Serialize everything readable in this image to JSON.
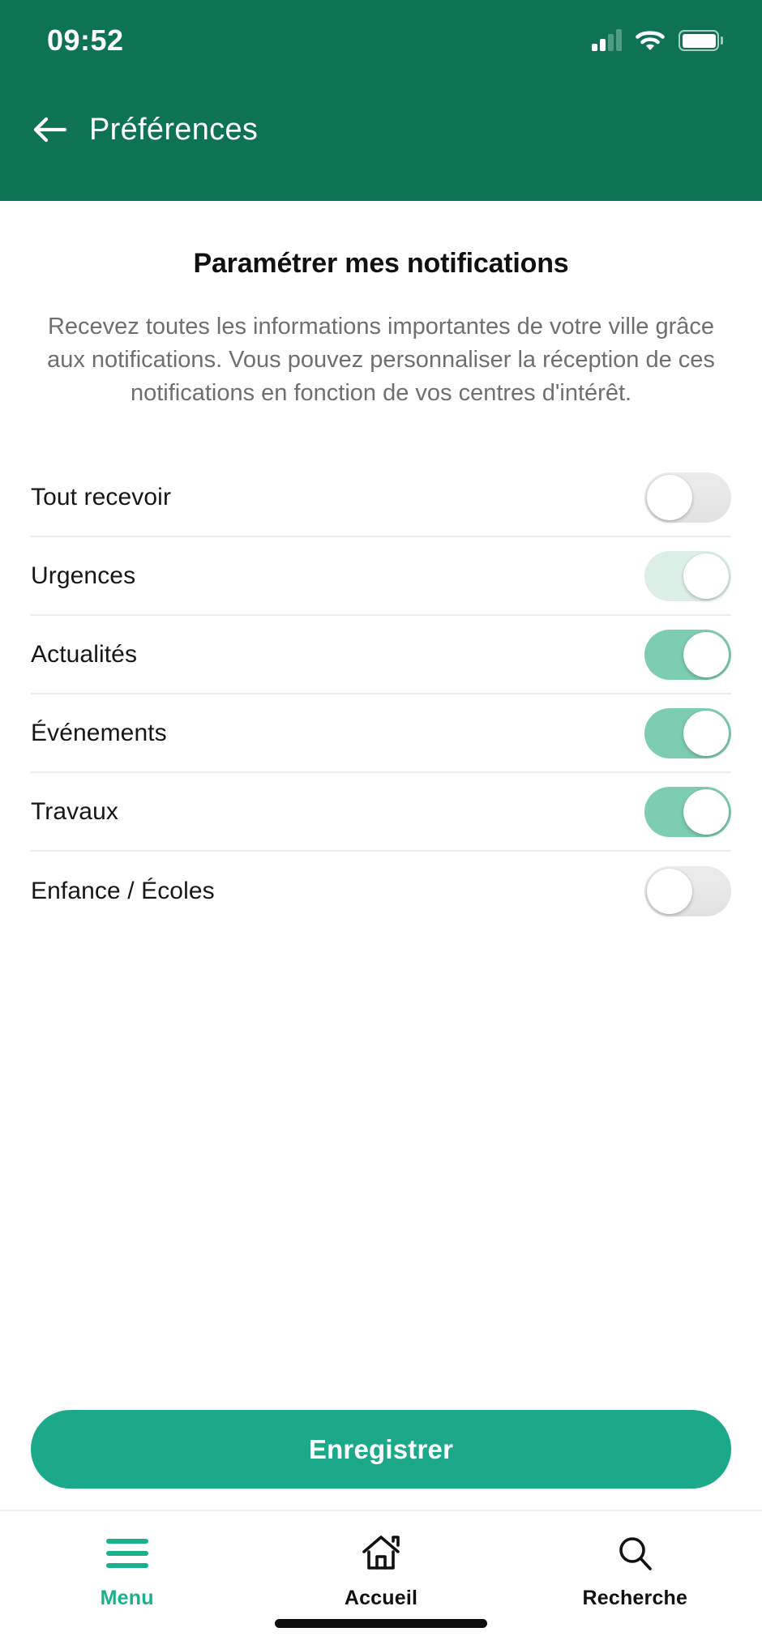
{
  "statusbar": {
    "time": "09:52",
    "signal_icon": "signal-bars-icon",
    "signal_bars_filled": 2,
    "signal_bars_total": 4,
    "wifi_icon": "wifi-icon",
    "battery_icon": "battery-icon"
  },
  "navbar": {
    "back_icon": "arrow-left-icon",
    "title": "Préférences"
  },
  "main": {
    "title": "Paramétrer mes notifications",
    "description": "Recevez toutes les informations importantes de votre ville grâce aux notifications. Vous pouvez personnaliser la réception de ces notifications en fonction de vos centres d'intérêt.",
    "toggles": [
      {
        "label": "Tout recevoir",
        "state": "off",
        "checked": false
      },
      {
        "label": "Urgences",
        "state": "on-faded",
        "checked": true
      },
      {
        "label": "Actualités",
        "state": "on-strong",
        "checked": true
      },
      {
        "label": "Événements",
        "state": "on-strong",
        "checked": true
      },
      {
        "label": "Travaux",
        "state": "on-strong",
        "checked": true
      },
      {
        "label": "Enfance / Écoles",
        "state": "off",
        "checked": false
      }
    ],
    "save_label": "Enregistrer"
  },
  "bottom_nav": {
    "items": [
      {
        "label": "Menu",
        "icon": "hamburger-menu-icon",
        "active": true
      },
      {
        "label": "Accueil",
        "icon": "home-icon",
        "active": false
      },
      {
        "label": "Recherche",
        "icon": "search-icon",
        "active": false
      }
    ]
  },
  "colors": {
    "header_green": "#0E7354",
    "accent_teal": "#1BA98A",
    "toggle_on": "#7ccdb2",
    "toggle_on_faded": "#dcefe7",
    "toggle_off": "#e7e7e7",
    "nav_active": "#19B18C",
    "text_primary": "#161616",
    "text_muted": "#6f6f6f",
    "divider": "#ececec"
  }
}
